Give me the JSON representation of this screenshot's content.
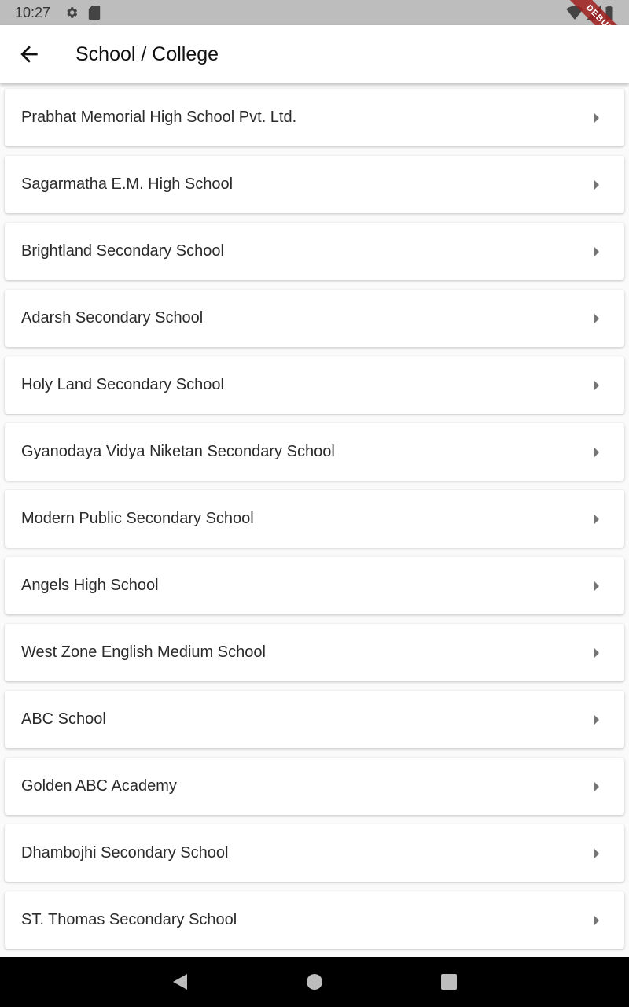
{
  "status_bar": {
    "time": "10:27",
    "icons": [
      "settings-icon",
      "sd-card-icon",
      "wifi-icon",
      "signal-icon",
      "battery-icon"
    ],
    "debug_label": "DEBUG"
  },
  "app_bar": {
    "title": "School / College",
    "back_icon": "arrow-back-icon"
  },
  "schools": [
    {
      "label": "Prabhat Memorial High School Pvt. Ltd."
    },
    {
      "label": "Sagarmatha E.M. High School"
    },
    {
      "label": "Brightland Secondary School"
    },
    {
      "label": "Adarsh Secondary School"
    },
    {
      "label": "Holy Land Secondary School"
    },
    {
      "label": "Gyanodaya Vidya Niketan Secondary School"
    },
    {
      "label": "Modern Public Secondary School"
    },
    {
      "label": "Angels High School"
    },
    {
      "label": "West Zone English Medium School"
    },
    {
      "label": "ABC School"
    },
    {
      "label": "Golden ABC Academy"
    },
    {
      "label": "Dhambojhi Secondary School"
    },
    {
      "label": "ST. Thomas Secondary School"
    }
  ],
  "nav_bar": {
    "icons": [
      "back-triangle-icon",
      "home-circle-icon",
      "recents-square-icon"
    ]
  }
}
